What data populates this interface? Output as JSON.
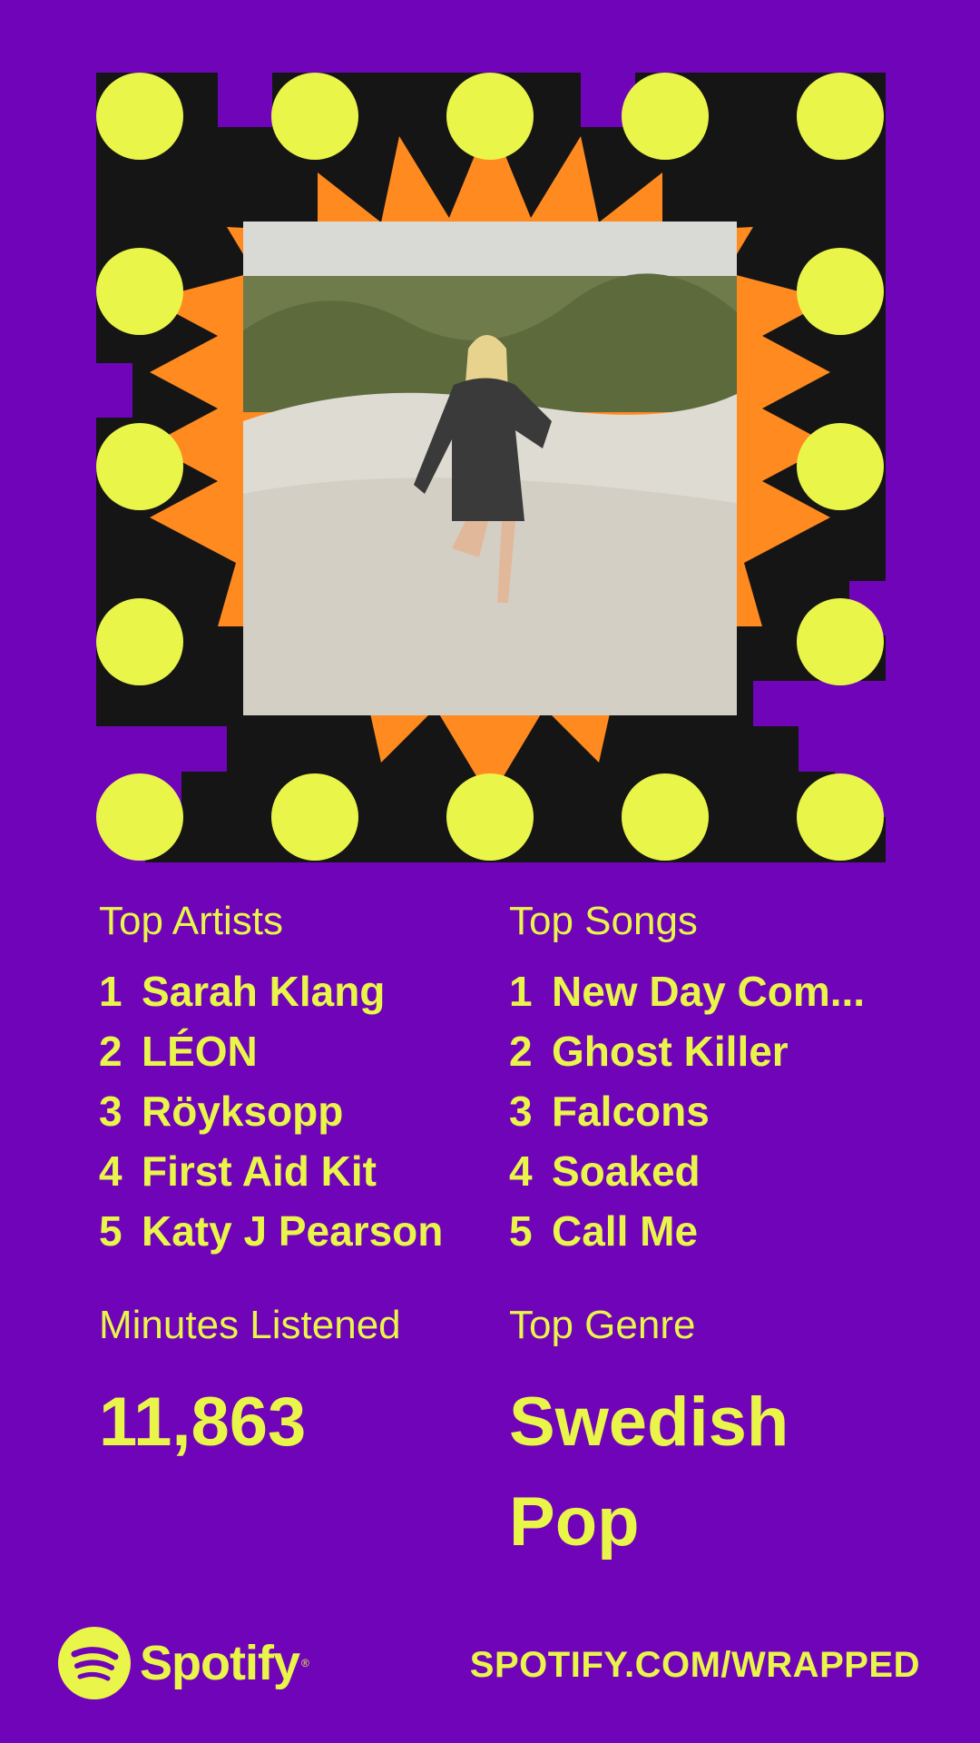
{
  "top_artists": {
    "label": "Top Artists",
    "items": [
      {
        "rank": "1",
        "name": "Sarah Klang"
      },
      {
        "rank": "2",
        "name": "LÉON"
      },
      {
        "rank": "3",
        "name": "Röyksopp"
      },
      {
        "rank": "4",
        "name": "First Aid Kit"
      },
      {
        "rank": "5",
        "name": "Katy J Pearson"
      }
    ]
  },
  "top_songs": {
    "label": "Top Songs",
    "items": [
      {
        "rank": "1",
        "name": "New Day Com..."
      },
      {
        "rank": "2",
        "name": "Ghost Killer"
      },
      {
        "rank": "3",
        "name": "Falcons"
      },
      {
        "rank": "4",
        "name": "Soaked"
      },
      {
        "rank": "5",
        "name": "Call Me"
      }
    ]
  },
  "minutes": {
    "label": "Minutes Listened",
    "value": "11,863"
  },
  "genre": {
    "label": "Top Genre",
    "value_line1": "Swedish",
    "value_line2": "Pop"
  },
  "footer": {
    "brand": "Spotify",
    "url": "SPOTIFY.COM/WRAPPED"
  },
  "colors": {
    "background": "#6f04b8",
    "text": "#eaf54a",
    "burst": "#ff8a1f",
    "steps": "#151515",
    "dots": "#eaf54a"
  },
  "icons": {
    "logo": "spotify-logo-icon"
  }
}
